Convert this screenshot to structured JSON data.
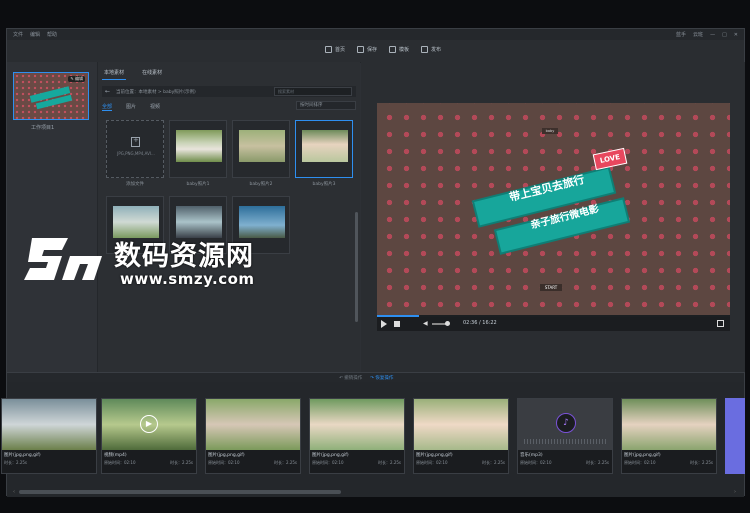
{
  "menu": [
    "文件",
    "编辑",
    "帮助"
  ],
  "window": {
    "user": "蓝手",
    "login": "云班"
  },
  "toolbar": [
    {
      "icon": "home-icon",
      "label": "首页"
    },
    {
      "icon": "save-icon",
      "label": "保存"
    },
    {
      "icon": "template-icon",
      "label": "模板"
    },
    {
      "icon": "publish-icon",
      "label": "发布"
    }
  ],
  "project": {
    "edit_badge": "✎ 编辑",
    "label": "工作项目1"
  },
  "material": {
    "tabs": [
      "本地素材",
      "在线素材"
    ],
    "path": "当前位置：本地素材 > baby照片(示例)",
    "search_placeholder": "搜索素材",
    "filters": [
      "全部",
      "图片",
      "视频"
    ],
    "sort": "按时间排序",
    "add_text": "JPG,PNG,MP4,AVI...",
    "items": [
      {
        "caption": "添加文件"
      },
      {
        "caption": "baby照片1"
      },
      {
        "caption": "baby照片2"
      },
      {
        "caption": "baby照片3"
      },
      {
        "caption": ""
      },
      {
        "caption": ""
      },
      {
        "caption": ""
      }
    ]
  },
  "preview": {
    "line1": "带上宝贝去旅行",
    "line2": "亲子旅行微电影",
    "love": "LOVE",
    "top_label": "baby",
    "start_label": "START",
    "time": "02:36 / 16:22",
    "progress_fraction": 0.12
  },
  "timeline": {
    "undo": "↶ 撤销操作",
    "redo": "↷ 恢复操作",
    "clips": [
      {
        "name": "图片(jpg,png,gif)",
        "meta": "时长：2.25s",
        "meta2": ""
      },
      {
        "name": "视频(mp4)",
        "meta": "原始时间：02:10",
        "meta2": "时长：2.25s"
      },
      {
        "name": "图片(jpg,png,gif)",
        "meta": "原始时间：02:10",
        "meta2": "时长：2.25s"
      },
      {
        "name": "图片(jpg,png,gif)",
        "meta": "原始时间：02:10",
        "meta2": "时长：2.25s"
      },
      {
        "name": "图片(jpg,png,gif)",
        "meta": "原始时间：02:10",
        "meta2": "时长：2.25s"
      },
      {
        "name": "音乐(mp3)",
        "meta": "原始时间：02:10",
        "meta2": "时长：2.25s"
      },
      {
        "name": "图片(jpg,png,gif)",
        "meta": "原始时间：02:10",
        "meta2": "时长：2.25s"
      }
    ]
  },
  "watermark": {
    "cn": "数码资源网",
    "url": "www.smzy.com"
  },
  "colors": {
    "accent": "#2e8ff0",
    "teal": "#17a69b",
    "heart": "#b34958",
    "love": "#e8475e"
  }
}
